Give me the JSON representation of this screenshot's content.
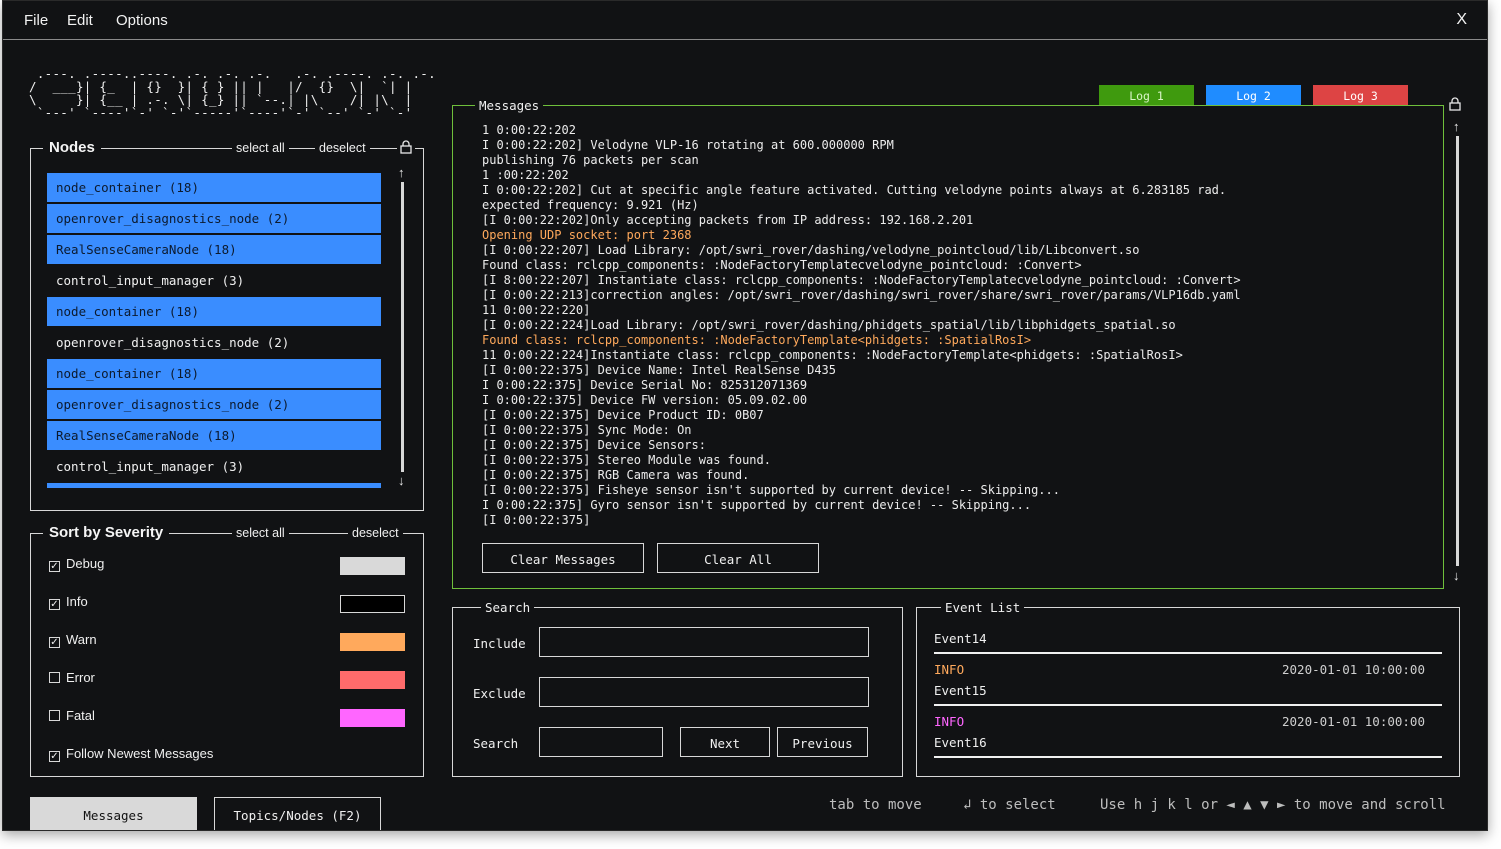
{
  "menu": {
    "file": "File",
    "edit": "Edit",
    "options": "Options",
    "close": "X"
  },
  "ascii_logo": " .---. .----..----. .-. .-. .-.   .-. .----. .-. .-.\n/  ___}| {_  | {}  }| { } || |   |/  {}  \\|  `| |\n\\     }| {__ | .-. \\| {_} || `--.| |\\    /| |\\  |\n `---' `----'`-' `-'`-----'`----'`-' `--' `-' `-'",
  "nodes": {
    "title": "Nodes",
    "select_all": "select all",
    "deselect": "deselect",
    "items": [
      {
        "label": "node_container (18)",
        "selected": true
      },
      {
        "label": "openrover_disagnostics_node (2)",
        "selected": true
      },
      {
        "label": "RealSenseCameraNode (18)",
        "selected": true
      },
      {
        "label": "control_input_manager (3)",
        "selected": false
      },
      {
        "label": "node_container (18)",
        "selected": true
      },
      {
        "label": "openrover_disagnostics_node (2)",
        "selected": false
      },
      {
        "label": "node_container (18)",
        "selected": true
      },
      {
        "label": "openrover_disagnostics_node (2)",
        "selected": true
      },
      {
        "label": "RealSenseCameraNode (18)",
        "selected": true
      },
      {
        "label": "control_input_manager (3)",
        "selected": false
      }
    ]
  },
  "severity": {
    "title": "Sort by Severity",
    "select_all": "select all",
    "deselect": "deselect",
    "levels": [
      {
        "label": "Debug",
        "checked": true,
        "color": "#d9d9d9"
      },
      {
        "label": "Info",
        "checked": true,
        "color": "#000000"
      },
      {
        "label": "Warn",
        "checked": true,
        "color": "#ffa95c"
      },
      {
        "label": "Error",
        "checked": false,
        "color": "#ff6b6b"
      },
      {
        "label": "Fatal",
        "checked": false,
        "color": "#ff66ff"
      }
    ],
    "follow_label": "Follow Newest Messages",
    "follow_checked": true
  },
  "bottom_tabs": {
    "messages": "Messages",
    "topics": "Topics/Nodes (F2)"
  },
  "log_tabs": [
    {
      "label": "Log 1",
      "color": "#3f9a0e"
    },
    {
      "label": "Log 2",
      "color": "#1f8cff"
    },
    {
      "label": "Log 3",
      "color": "#dd4444"
    }
  ],
  "messages": {
    "title": "Messages",
    "lines": [
      {
        "text": "1 0:00:22:202",
        "level": "info"
      },
      {
        "text": "I 0:00:22:202] Velodyne VLP-16 rotating at 600.000000 RPM",
        "level": "info"
      },
      {
        "text": "publishing 76 packets per scan",
        "level": "info"
      },
      {
        "text": "1 :00:22:202",
        "level": "info"
      },
      {
        "text": "I 0:00:22:202] Cut at specific angle feature activated. Cutting velodyne points always at 6.283185 rad.",
        "level": "info"
      },
      {
        "text": "expected frequency: 9.921 (Hz)",
        "level": "info"
      },
      {
        "text": "[I 0:00:22:202]Only accepting packets from IP address: 192.168.2.201",
        "level": "info"
      },
      {
        "text": "Opening UDP socket: port 2368",
        "level": "warn"
      },
      {
        "text": "[I 0:00:22:207] Load Library: /opt/swri_rover/dashing/velodyne_pointcloud/lib/Libconvert.so",
        "level": "info"
      },
      {
        "text": "Found class: rclcpp_components: :NodeFactoryTemplatecvelodyne_pointcloud: :Convert>",
        "level": "info"
      },
      {
        "text": "[I 8:00:22:207] Instantiate class: rclcpp_components: :NodeFactoryTemplatecvelodyne_pointcloud: :Convert>",
        "level": "info"
      },
      {
        "text": "[I 0:00:22:213]correction angles: /opt/swri_rover/dashing/swri_rover/share/swri_rover/params/VLP16db.yaml",
        "level": "info"
      },
      {
        "text": "11 0:00:22:220]",
        "level": "info"
      },
      {
        "text": "[I 0:00:22:224]Load Library: /opt/swri_rover/dashing/phidgets_spatial/lib/libphidgets_spatial.so",
        "level": "info"
      },
      {
        "text": "Found class: rclcpp_components: :NodeFactoryTemplate<phidgets: :SpatialRosI>",
        "level": "warn"
      },
      {
        "text": "11 0:00:22:224]Instantiate class: rclcpp_components: :NodeFactoryTemplate<phidgets: :SpatialRosI>",
        "level": "info"
      },
      {
        "text": "[I 0:00:22:375] Device Name: Intel RealSense D435",
        "level": "info"
      },
      {
        "text": "I 0:00:22:375] Device Serial No: 825312071369",
        "level": "info"
      },
      {
        "text": "I 0:00:22:375] Device FW version: 05.09.02.00",
        "level": "info"
      },
      {
        "text": "[I 0:00:22:375] Device Product ID: 0B07",
        "level": "info"
      },
      {
        "text": "[I 0:00:22:375] Sync Mode: On",
        "level": "info"
      },
      {
        "text": "[I 0:00:22:375] Device Sensors:",
        "level": "info"
      },
      {
        "text": "[I 0:00:22:375] Stereo Module was found.",
        "level": "info"
      },
      {
        "text": "[I 0:00:22:375] RGB Camera was found.",
        "level": "info"
      },
      {
        "text": "[I 0:00:22:375] Fisheye sensor isn't supported by current device! -- Skipping...",
        "level": "info"
      },
      {
        "text": "I 0:00:22:375] Gyro sensor isn't supported by current device! -- Skipping...",
        "level": "info"
      },
      {
        "text": "[I 0:00:22:375]",
        "level": "info"
      }
    ],
    "clear_messages": "Clear Messages",
    "clear_all": "Clear All"
  },
  "search": {
    "title": "Search",
    "include_label": "Include",
    "exclude_label": "Exclude",
    "search_label": "Search",
    "include_value": "",
    "exclude_value": "",
    "search_value": "",
    "next": "Next",
    "previous": "Previous"
  },
  "events": {
    "title": "Event List",
    "items": [
      {
        "name": "Event14",
        "level": "",
        "level_color": "",
        "time": ""
      },
      {
        "name": "Event15",
        "level": "INFO",
        "level_color": "#ffa95c",
        "time": "2020-01-01 10:00:00"
      },
      {
        "name": "Event16",
        "level": "INFO",
        "level_color": "#ff66ff",
        "time": "2020-01-01 10:00:00"
      }
    ]
  },
  "hints": {
    "tab": "tab to move",
    "enter": "↲ to select",
    "scroll": "Use h j k l or ◄ ▲ ▼ ► to move and scroll"
  },
  "colors": {
    "accent_blue": "#3a8dff",
    "messages_border": "#6fbf3b",
    "warn_text": "#ffa95c"
  }
}
